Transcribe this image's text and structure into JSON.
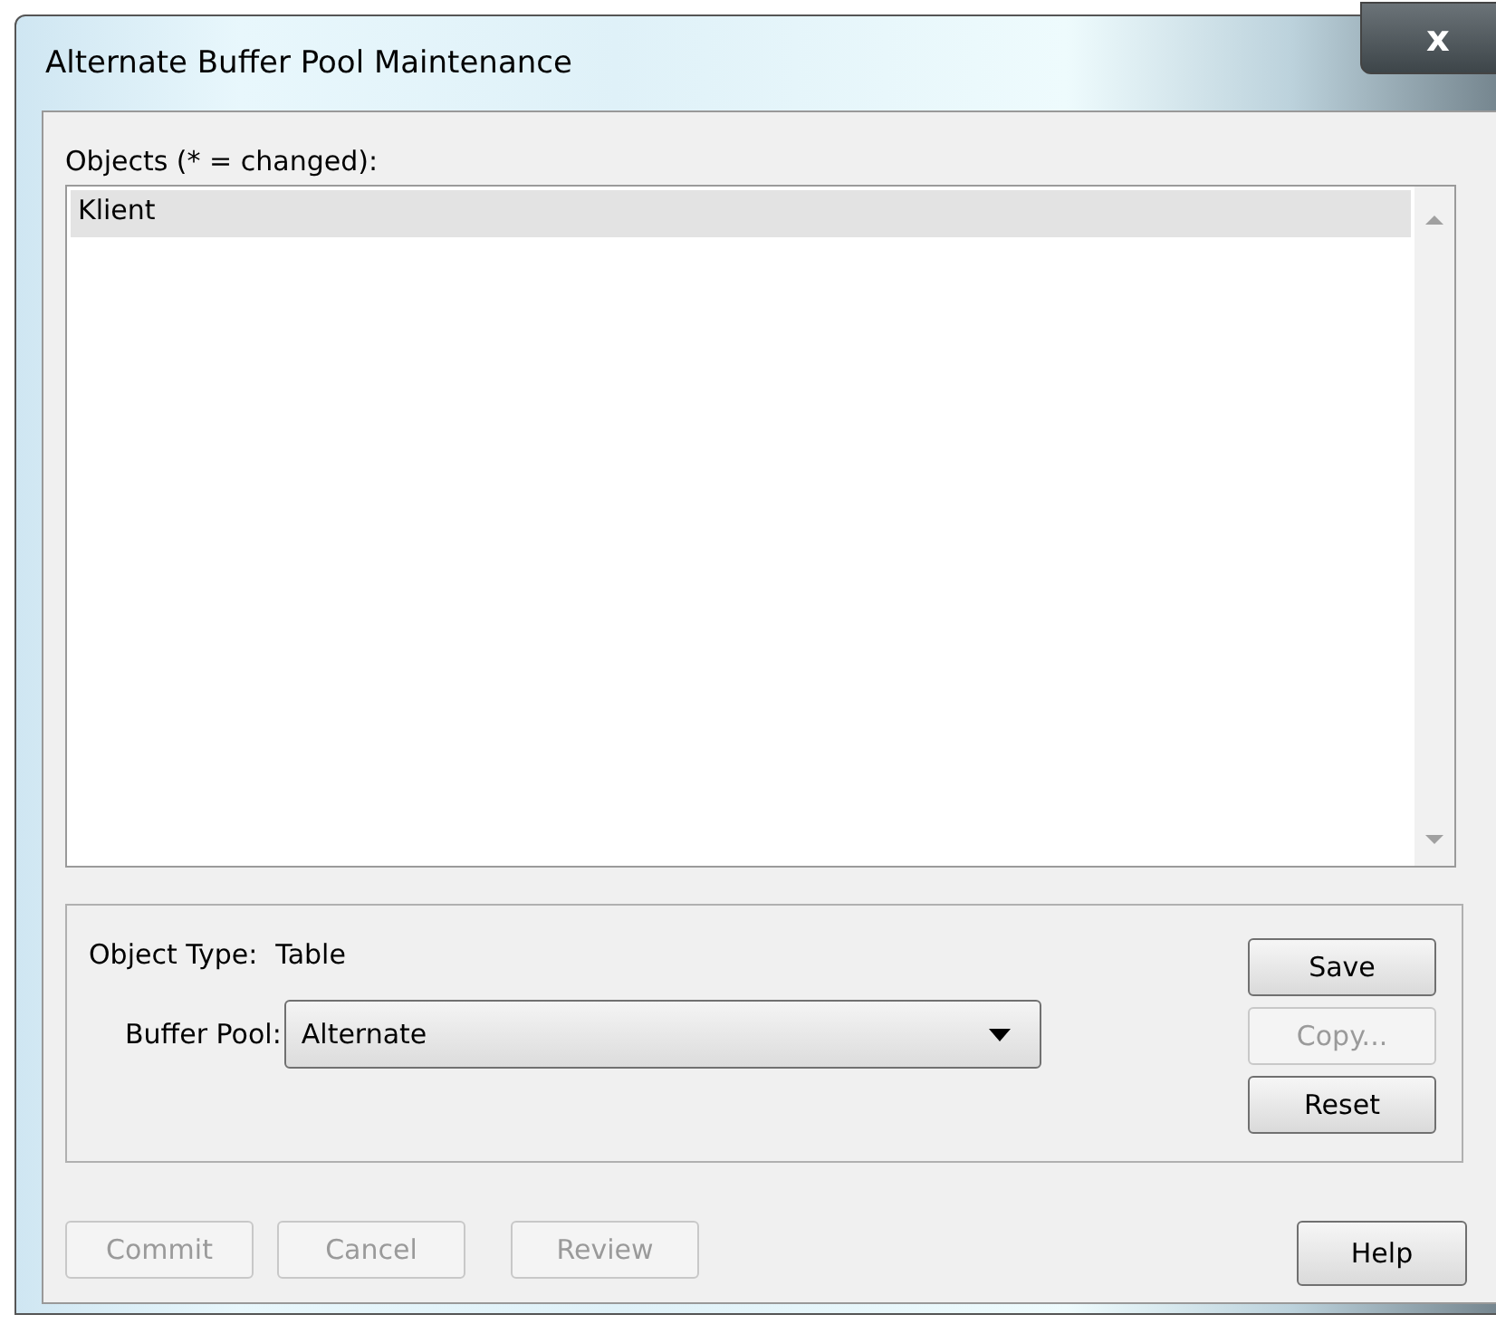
{
  "window": {
    "title": "Alternate Buffer Pool Maintenance",
    "close": "x"
  },
  "objects": {
    "label": "Objects (* = changed):",
    "items": [
      {
        "name": "Klient",
        "selected": true
      }
    ]
  },
  "details": {
    "type_label": "Object Type:",
    "type_value": "Table",
    "pool_label": "Buffer Pool:",
    "pool_value": "Alternate"
  },
  "side_buttons": [
    {
      "label": "Save",
      "disabled": false
    },
    {
      "label": "Copy...",
      "disabled": true
    },
    {
      "label": "Reset",
      "disabled": false
    }
  ],
  "bottom_buttons": [
    {
      "label": "Commit",
      "disabled": true
    },
    {
      "label": "Cancel",
      "disabled": true
    },
    {
      "label": "Review",
      "disabled": true
    }
  ],
  "help_button": {
    "label": "Help",
    "disabled": false
  }
}
